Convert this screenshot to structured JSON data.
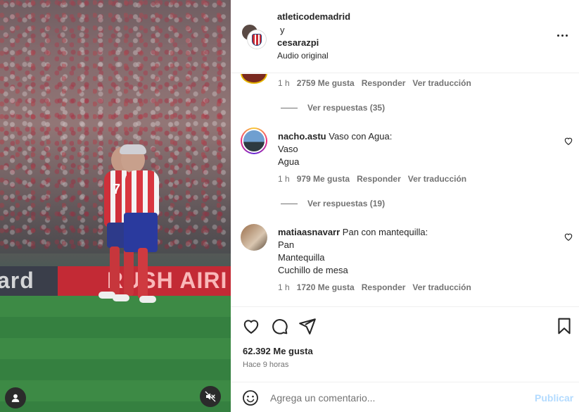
{
  "media": {
    "board_left": "ard",
    "board_right": "RUSH AIRI",
    "jersey_number": "7",
    "tag_icon": "person-tag-icon",
    "mute_icon": "speaker-muted-icon"
  },
  "header": {
    "user1": "atleticodemadrid",
    "and": "y",
    "user2": "cesarazpi",
    "audio": "Audio original",
    "more_icon": "more-options-icon"
  },
  "comments": {
    "top_meta": {
      "time": "1 h",
      "likes": "2759 Me gusta",
      "reply": "Responder",
      "translate": "Ver traducción"
    },
    "top_replies": "Ver respuestas (35)",
    "items": [
      {
        "user": "nacho.astu",
        "text": "Vaso con Agua:",
        "lines": [
          "Vaso",
          "Agua"
        ],
        "time": "1 h",
        "likes": "979 Me gusta",
        "reply": "Responder",
        "translate": "Ver traducción",
        "replies": "Ver respuestas (19)"
      },
      {
        "user": "matiaasnavarr",
        "text": "Pan con mantequilla:",
        "lines": [
          "Pan",
          "Mantequilla",
          "Cuchillo de mesa"
        ],
        "time": "1 h",
        "likes": "1720 Me gusta",
        "reply": "Responder",
        "translate": "Ver traducción"
      }
    ]
  },
  "actions": {
    "likes": "62.392 Me gusta",
    "time_ago": "Hace 9 horas"
  },
  "add_comment": {
    "placeholder": "Agrega un comentario...",
    "publish": "Publicar"
  },
  "colors": {
    "text": "#262626",
    "muted": "#737373",
    "publish_disabled": "#b3dbff",
    "divider": "#efefef"
  }
}
